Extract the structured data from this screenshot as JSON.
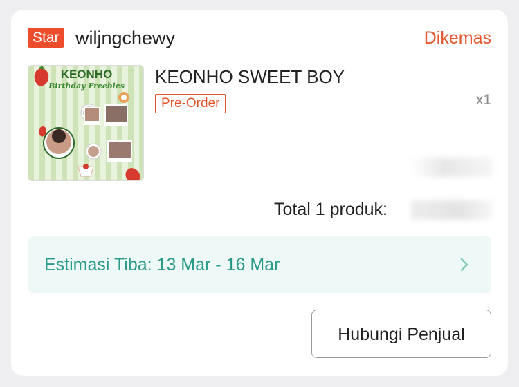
{
  "shop": {
    "badge": "Star",
    "name": "wiljngchewy",
    "status": "Dikemas"
  },
  "product": {
    "title": "KEONHO SWEET BOY",
    "tag": "Pre-Order",
    "quantity": "x1",
    "thumbnail": {
      "heading": "KEONHO",
      "subheading": "Birthday Freebies"
    }
  },
  "summary": {
    "total_label": "Total 1 produk:"
  },
  "estimate": {
    "label": "Estimasi Tiba: 13 Mar - 16 Mar",
    "icon": "chevron-right-icon"
  },
  "actions": {
    "contact_seller": "Hubungi Penjual"
  },
  "colors": {
    "accent": "#ee4d2d",
    "status": "#e4562e",
    "estimate_text": "#2a9b8a",
    "estimate_bg": "#eef8f6"
  }
}
